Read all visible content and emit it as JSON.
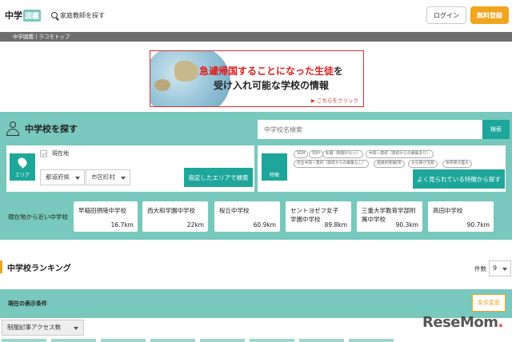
{
  "header": {
    "logo_pre": "中学",
    "logo_box": "図鑑",
    "tutor_link": "家庭教師を探す",
    "login": "ログイン",
    "signup": "無料登録"
  },
  "breadcrumb": "中学図鑑 | ラコモトップ",
  "banner": {
    "line1_red": "急遽帰国することになった生徒",
    "line1_tail": "を",
    "line2": "受け入れ可能な学校の情報",
    "link": "▶ こちらをクリック"
  },
  "search": {
    "title": "中学校を探す",
    "name_placeholder": "中学校名検索",
    "search_button": "検索",
    "area_badge": "エリア",
    "current_location": "現在地",
    "prefecture": "都道府県",
    "city": "市区町村",
    "area_button": "指定したエリアで検索",
    "feature_badge": "特徴",
    "tags": [
      "SGH",
      "SSH",
      "私服（制服がない）",
      "中高一貫校（高校からの募集あり）",
      "完全中高一貫校（高校からの募集なし）",
      "過帰校受験OK",
      "文化祭が活発",
      "体育祭が盛大"
    ],
    "feature_button": "よく見られている特徴から探す"
  },
  "nearby": {
    "label": "現在地から近い中学校",
    "schools": [
      {
        "name": "早稲田摂陵中学校",
        "dist": "16.7km"
      },
      {
        "name": "西大和学園中学校",
        "dist": "22km"
      },
      {
        "name": "桜丘中学校",
        "dist": "60.9km"
      },
      {
        "name": "セントヨゼフ女子学園中学校",
        "dist": "89.8km"
      },
      {
        "name": "三重大学教育学部附属中学校",
        "dist": "90.3km"
      },
      {
        "name": "高田中学校",
        "dist": "90.7km"
      }
    ]
  },
  "ranking": {
    "title": "中学校ランキング",
    "count_label": "件数",
    "count_value": "9",
    "condition_label": "現在の表示条件",
    "condition_button": "条件変更",
    "sort_value": "制服記事アクセス数"
  },
  "watermark": {
    "main": "ReseMom",
    "dot": "."
  }
}
